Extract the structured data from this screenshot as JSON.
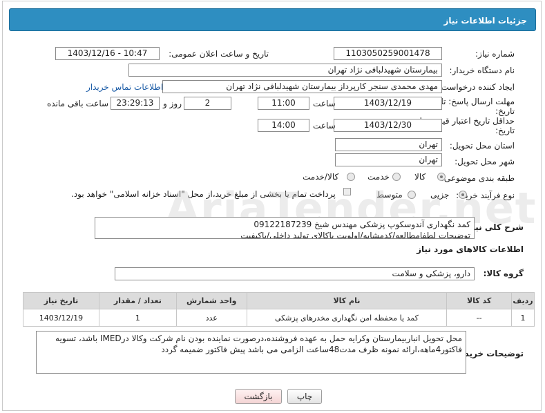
{
  "header": {
    "title": "جزئیات اطلاعات نیاز"
  },
  "form": {
    "need_number": {
      "label": "شماره نیاز:",
      "value": "1103050259001478"
    },
    "announce_datetime": {
      "label": "تاریخ و ساعت اعلان عمومی:",
      "value": "1403/12/16 - 10:47"
    },
    "buyer_org": {
      "label": "نام دستگاه خریدار:",
      "value": "بیمارستان شهیدلبافی نژاد تهران"
    },
    "requester": {
      "label": "ایجاد کننده درخواست:",
      "value": "مهدی محمدی سنجر کارپرداز بیمارستان شهیدلبافی نژاد تهران",
      "contact_link": "اطلاعات تماس خریدار"
    },
    "reply_deadline": {
      "label_line1": "مهلت ارسال پاسخ: تا",
      "label_line2": "تاریخ:",
      "date": "1403/12/19",
      "time_label": "ساعت",
      "time": "11:00",
      "days": "2",
      "days_label": "روز و",
      "remaining": "23:29:13",
      "remaining_label": "ساعت باقی مانده"
    },
    "price_validity": {
      "label_line1": "حداقل تاریخ اعتبار قیمت: تا",
      "label_line2": "تاریخ:",
      "date": "1403/12/30",
      "time_label": "ساعت",
      "time": "14:00"
    },
    "province": {
      "label": "استان محل تحویل:",
      "value": "تهران"
    },
    "city": {
      "label": "شهر محل تحویل:",
      "value": "تهران"
    },
    "category": {
      "label": "طبقه بندی موضوعی:",
      "options": [
        "کالا",
        "خدمت",
        "کالا/خدمت"
      ],
      "selected": "کالا"
    },
    "purchase_type": {
      "label": "نوع فرآیند خرید :",
      "options": [
        "جزیی",
        "متوسط"
      ],
      "selected": "جزیی",
      "payment_note": "پرداخت تمام یا بخشی از مبلغ خرید،از محل \"اسناد خزانه اسلامی\" خواهد بود."
    }
  },
  "need_summary": {
    "label": "شرح کلی نیاز:",
    "line1": "کمد نگهداری آندوسکوپ پزشکی مهندس شیخ 09122187239",
    "line2": "توضیحات لطفامطالعه/کدمشابه/اولویت باکالای تولید داخلی/باکیفیت"
  },
  "goods_info": {
    "title": "اطلاعات کالاهای مورد نیاز",
    "group_label": "گروه کالا:",
    "group_value": "دارو، پزشکی و سلامت"
  },
  "table": {
    "headers": [
      "ردیف",
      "کد کالا",
      "نام کالا",
      "واحد شمارش",
      "تعداد / مقدار",
      "تاریخ نیاز"
    ],
    "rows": [
      [
        "1",
        "--",
        "کمد یا محفظه امن نگهداری مخدرهای پزشکی",
        "عدد",
        "1",
        "1403/12/19"
      ]
    ]
  },
  "buyer_notes": {
    "label": "توضیحات خریدار:",
    "line1": "محل تحویل انباربیمارستان وکرایه حمل به عهده فروشنده،درصورت نماینده بودن نام شرکت وکالا درIMED باشد، تسویه",
    "line2": "فاکتور4ماهه،ارائه نمونه ظرف مدت48ساعت الزامی می باشد پیش فاکتور ضمیمه گردد"
  },
  "buttons": {
    "print": "چاپ",
    "back": "بازگشت"
  },
  "watermark": "AriaTender.net",
  "colors": {
    "header_bg": "#2e8ec1",
    "link": "#1a5ba6",
    "table_header_bg": "#dcdcdc"
  }
}
